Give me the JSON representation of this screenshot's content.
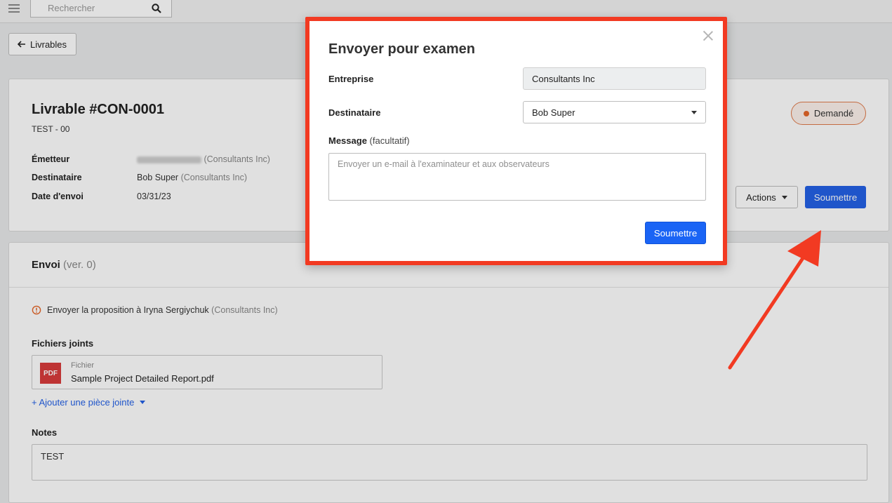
{
  "topbar": {
    "search_placeholder": "Rechercher"
  },
  "back_button": {
    "label": "Livrables"
  },
  "deliverable": {
    "title": "Livrable #CON-0001",
    "subtitle": "TEST - 00",
    "status": "Demandé",
    "status_color": "#e5672a",
    "fields": {
      "sender_label": "Émetteur",
      "sender_company": "(Consultants Inc)",
      "recipient_label": "Destinataire",
      "recipient_name": "Bob Super",
      "recipient_company": "(Consultants Inc)",
      "date_label": "Date d'envoi",
      "date_value": "03/31/23"
    },
    "actions_label": "Actions",
    "submit_label": "Soumettre"
  },
  "submission": {
    "title": "Envoi",
    "version": "(ver. 0)",
    "warning_text": "Envoyer la proposition à Iryna Sergiychuk",
    "warning_company": "(Consultants Inc)",
    "attachments_label": "Fichiers joints",
    "file": {
      "icon_text": "PDF",
      "kind": "Fichier",
      "name": "Sample Project Detailed Report.pdf"
    },
    "add_attachment_label": "+ Ajouter une pièce jointe",
    "notes_label": "Notes",
    "notes_value": "TEST"
  },
  "modal": {
    "title": "Envoyer pour examen",
    "company_label": "Entreprise",
    "company_value": "Consultants Inc",
    "recipient_label": "Destinataire",
    "recipient_value": "Bob Super",
    "message_label": "Message",
    "message_optional": "(facultatif)",
    "message_placeholder": "Envoyer un e-mail à l'examinateur et aux observateurs",
    "submit_label": "Soumettre",
    "highlight_color": "#f23a22"
  },
  "colors": {
    "primary": "#2461e6",
    "annotation": "#f23a22"
  }
}
